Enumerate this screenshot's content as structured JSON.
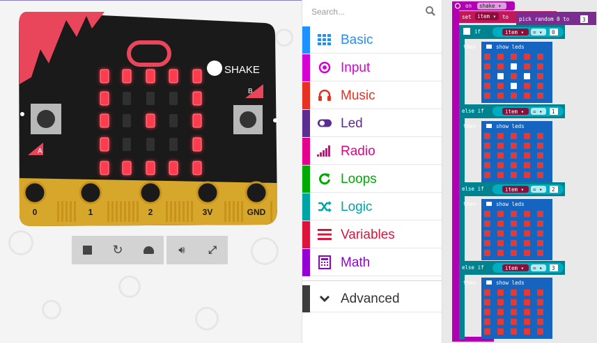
{
  "simulator": {
    "shake_label": "SHAKE",
    "button_a": "A",
    "button_b": "B",
    "pins": [
      "0",
      "1",
      "2",
      "3V",
      "GND"
    ],
    "led_matrix": [
      [
        1,
        1,
        1,
        1,
        1
      ],
      [
        1,
        0,
        0,
        0,
        1
      ],
      [
        1,
        0,
        1,
        0,
        1
      ],
      [
        1,
        0,
        0,
        0,
        1
      ],
      [
        1,
        1,
        1,
        1,
        1
      ]
    ],
    "controls": [
      "stop-icon",
      "restart-icon",
      "slowmo-icon",
      "sound-icon",
      "fullscreen-icon"
    ]
  },
  "toolbox": {
    "search_placeholder": "Search...",
    "categories": [
      {
        "label": "Basic",
        "color": "#1e90ff",
        "icon": "grid-icon"
      },
      {
        "label": "Input",
        "color": "#d400d4",
        "icon": "target-icon"
      },
      {
        "label": "Music",
        "color": "#e63022",
        "icon": "headphones-icon"
      },
      {
        "label": "Led",
        "color": "#5c2d91",
        "icon": "toggle-icon"
      },
      {
        "label": "Radio",
        "color": "#e3008c",
        "icon": "signal-bars-icon"
      },
      {
        "label": "Loops",
        "color": "#00aa00",
        "icon": "refresh-icon"
      },
      {
        "label": "Logic",
        "color": "#00a4a6",
        "icon": "shuffle-icon"
      },
      {
        "label": "Variables",
        "color": "#dc143c",
        "icon": "lines-icon"
      },
      {
        "label": "Math",
        "color": "#9400d3",
        "icon": "calculator-icon"
      }
    ],
    "advanced": {
      "label": "Advanced",
      "color": "#3c3c3c",
      "icon": "chevron-down-icon"
    }
  },
  "workspace": {
    "event_label": "on",
    "event_value": "shake",
    "set_label": "set",
    "var_name": "item",
    "to_label": "to",
    "pick_random_label": "pick random 0 to",
    "pick_random_max": "3",
    "if_label": "if",
    "then_label": "then",
    "else_if_label": "else if",
    "op_label": "=",
    "show_leds_label": "show leds",
    "conditions": [
      "0",
      "1",
      "2",
      "3"
    ],
    "patterns": [
      [
        [
          0,
          0,
          0,
          0,
          0
        ],
        [
          0,
          0,
          1,
          0,
          0
        ],
        [
          0,
          1,
          0,
          1,
          0
        ],
        [
          0,
          0,
          1,
          0,
          0
        ],
        [
          0,
          0,
          0,
          0,
          0
        ]
      ],
      [
        [
          0,
          0,
          0,
          0,
          0
        ],
        [
          0,
          0,
          0,
          0,
          0
        ],
        [
          0,
          0,
          0,
          0,
          0
        ],
        [
          0,
          0,
          0,
          0,
          0
        ],
        [
          0,
          0,
          0,
          0,
          0
        ]
      ],
      [
        [
          0,
          0,
          0,
          0,
          0
        ],
        [
          0,
          0,
          0,
          0,
          0
        ],
        [
          0,
          0,
          0,
          0,
          0
        ],
        [
          0,
          0,
          0,
          0,
          0
        ],
        [
          0,
          0,
          0,
          0,
          0
        ]
      ],
      [
        [
          0,
          0,
          0,
          0,
          0
        ],
        [
          0,
          0,
          0,
          0,
          0
        ],
        [
          0,
          0,
          0,
          0,
          0
        ],
        [
          0,
          0,
          0,
          0,
          0
        ],
        [
          0,
          0,
          0,
          0,
          0
        ]
      ]
    ]
  }
}
